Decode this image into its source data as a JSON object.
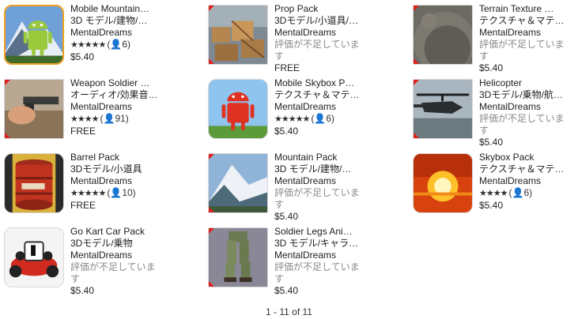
{
  "items": [
    {
      "title": "Mobile Mountain…",
      "category": "3D モデル/建物/…",
      "publisher": "MentalDreams",
      "stars": "★★★★★",
      "reviews": "(👤6)",
      "price": "$5.40",
      "rating_text": ""
    },
    {
      "title": "Prop Pack",
      "category": "3Dモデル/小道具/…",
      "publisher": "MentalDreams",
      "stars": "",
      "reviews": "",
      "rating_text": "評価が不足しています",
      "price": "FREE"
    },
    {
      "title": "Terrain Texture …",
      "category": "テクスチャ＆マテ…",
      "publisher": "MentalDreams",
      "stars": "",
      "reviews": "",
      "rating_text": "評価が不足しています",
      "price": "$5.40"
    },
    {
      "title": "Weapon Soldier …",
      "category": "オーディオ/効果音…",
      "publisher": "MentalDreams",
      "stars": "★★★★",
      "reviews": "(👤91)",
      "price": "FREE",
      "rating_text": ""
    },
    {
      "title": "Mobile Skybox P…",
      "category": "テクスチャ＆マテ…",
      "publisher": "MentalDreams",
      "stars": "★★★★★",
      "reviews": "(👤6)",
      "price": "$5.40",
      "rating_text": ""
    },
    {
      "title": "Helicopter",
      "category": "3Dモデル/乗物/航…",
      "publisher": "MentalDreams",
      "stars": "",
      "reviews": "",
      "rating_text": "評価が不足しています",
      "price": "$5.40"
    },
    {
      "title": "Barrel Pack",
      "category": "3Dモデル/小道具",
      "publisher": "MentalDreams",
      "stars": "★★★★★",
      "reviews": "(👤10)",
      "price": "FREE",
      "rating_text": ""
    },
    {
      "title": "Mountain Pack",
      "category": "3D モデル/建物/…",
      "publisher": "MentalDreams",
      "stars": "",
      "reviews": "",
      "rating_text": "評価が不足しています",
      "price": "$5.40"
    },
    {
      "title": "Skybox Pack",
      "category": "テクスチャ＆マテ…",
      "publisher": "MentalDreams",
      "stars": "★★★★",
      "reviews": "(👤6)",
      "price": "$5.40",
      "rating_text": ""
    },
    {
      "title": "Go Kart Car Pack",
      "category": "3Dモデル/乗物",
      "publisher": "MentalDreams",
      "stars": "",
      "reviews": "",
      "rating_text": "評価が不足しています",
      "price": "$5.40"
    },
    {
      "title": "Soldier Legs Ani…",
      "category": "3D モデル/キャラ…",
      "publisher": "MentalDreams",
      "stars": "",
      "reviews": "",
      "rating_text": "評価が不足しています",
      "price": "$5.40"
    }
  ],
  "pagination": {
    "label": "1 - 11 of 11"
  }
}
